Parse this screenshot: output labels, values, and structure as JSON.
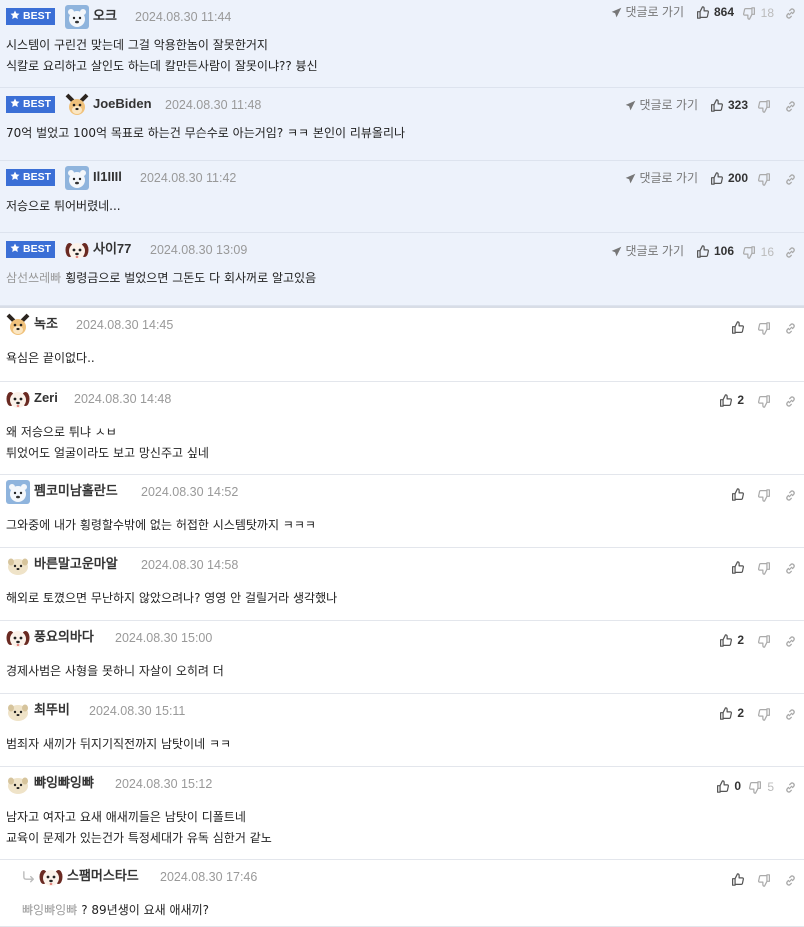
{
  "colors": {
    "best_bg": "#edf2fb",
    "badge": "#3b6fd6",
    "meta": "#999999",
    "icon": "#888888"
  },
  "icons": {
    "best": "star-icon",
    "reply": "paper-plane-icon",
    "like": "thumbs-up-icon",
    "dislike": "thumbs-down-icon",
    "share": "link-icon",
    "reply_indent": "reply-arrow-icon"
  },
  "best_label": "BEST",
  "reply_label": "댓글로 가기",
  "comments": [
    {
      "best": true,
      "avatar": "polar-bear",
      "nick": "오크",
      "date": "2024.08.30 11:44",
      "likes": "864",
      "dislikes": "18",
      "lines": [
        "시스템이 구린건 맞는데 그걸 악용한놈이 잘못한거지",
        "식칼로 요리하고 살인도 하는데 칼만든사람이 잘못이냐?? 븅신"
      ]
    },
    {
      "best": true,
      "avatar": "dog",
      "nick": "JoeBiden",
      "date": "2024.08.30 11:48",
      "likes": "323",
      "dislikes": "",
      "lines": [
        "70억 벌었고 100억 목표로 하는건 무슨수로 아는거임? ㅋㅋ 본인이 리뷰올리나"
      ]
    },
    {
      "best": true,
      "avatar": "polar-bear",
      "nick": "Il1IIIl",
      "date": "2024.08.30 11:42",
      "likes": "200",
      "dislikes": "",
      "lines": [
        "저승으로 튀어버렸네..."
      ]
    },
    {
      "best": true,
      "avatar": "puppy",
      "nick": "사이77",
      "date": "2024.08.30 13:09",
      "likes": "106",
      "dislikes": "16",
      "mention": "삼선쓰레빠",
      "lines": [
        "횡령금으로 벌었으면 그돈도 다 회사꺼로 알고있음"
      ]
    },
    {
      "best": false,
      "avatar": "dog",
      "nick": "녹조",
      "date": "2024.08.30 14:45",
      "likes": "",
      "dislikes": "",
      "lines": [
        "욕심은 끝이없다.."
      ]
    },
    {
      "best": false,
      "avatar": "puppy",
      "nick": "Zeri",
      "date": "2024.08.30 14:48",
      "likes": "2",
      "dislikes": "",
      "lines": [
        "왜 저승으로 튀냐 ㅅㅂ",
        "튀었어도 얼굴이라도 보고 망신주고 싶네"
      ]
    },
    {
      "best": false,
      "avatar": "polar-bear",
      "nick": "펨코미남홀란드",
      "date": "2024.08.30 14:52",
      "likes": "",
      "dislikes": "",
      "lines": [
        "그와중에 내가 횡령할수밖에 없는 허접한 시스템탓까지 ㅋㅋㅋ"
      ]
    },
    {
      "best": false,
      "avatar": "egg",
      "nick": "바른말고운마알",
      "date": "2024.08.30 14:58",
      "likes": "",
      "dislikes": "",
      "lines": [
        "해외로 토꼈으면 무난하지 않았으려나? 영영 안 걸릴거라 생각했나"
      ]
    },
    {
      "best": false,
      "avatar": "puppy",
      "nick": "풍요의바다",
      "date": "2024.08.30 15:00",
      "likes": "2",
      "dislikes": "",
      "lines": [
        "경제사범은 사형을 못하니 자살이 오히려 더"
      ]
    },
    {
      "best": false,
      "avatar": "egg",
      "nick": "최뚜비",
      "date": "2024.08.30 15:11",
      "likes": "2",
      "dislikes": "",
      "lines": [
        "범죄자 새끼가 뒤지기직전까지 남탓이네 ㅋㅋ"
      ]
    },
    {
      "best": false,
      "avatar": "egg",
      "nick": "뺘잉뺘잉뺘",
      "date": "2024.08.30 15:12",
      "likes": "0",
      "dislikes": "5",
      "lines": [
        "남자고 여자고 요새 애새끼들은 남탓이 디폴트네",
        "교육이 문제가 있는건가 특정세대가 유독 심한거 같노"
      ]
    },
    {
      "best": false,
      "reply": true,
      "avatar": "puppy",
      "nick": "스팸머스타드",
      "date": "2024.08.30 17:46",
      "likes": "",
      "dislikes": "",
      "mention": "뺘잉뺘잉뺘",
      "lines": [
        "? 89년생이 요새 애새끼?"
      ]
    }
  ]
}
